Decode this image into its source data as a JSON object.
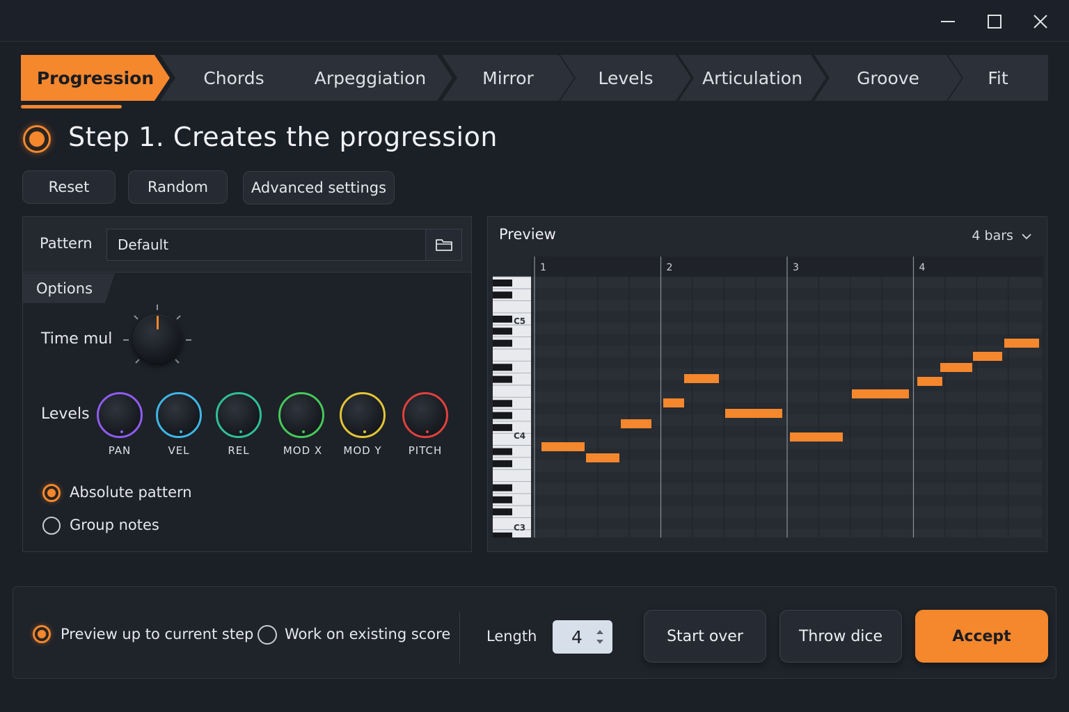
{
  "window": {
    "minimize_icon": "minimize-icon",
    "maximize_icon": "maximize-icon",
    "close_icon": "close-icon"
  },
  "tabs": [
    {
      "label": "Progression",
      "active": true
    },
    {
      "label": "Chords"
    },
    {
      "label": "Arpeggiation"
    },
    {
      "label": "Mirror"
    },
    {
      "label": "Levels"
    },
    {
      "label": "Articulation"
    },
    {
      "label": "Groove"
    },
    {
      "label": "Fit"
    }
  ],
  "step": {
    "title": "Step 1. Creates the progression"
  },
  "actions": {
    "reset": "Reset",
    "random": "Random",
    "advanced": "Advanced settings"
  },
  "pattern": {
    "label": "Pattern",
    "value": "Default",
    "browse_icon": "folder-icon"
  },
  "options": {
    "tab_label": "Options",
    "time_mul_label": "Time mul",
    "levels_label": "Levels",
    "levels": [
      {
        "label": "PAN",
        "color": "#8f5cf0"
      },
      {
        "label": "VEL",
        "color": "#3fb6e6"
      },
      {
        "label": "REL",
        "color": "#2fbf97"
      },
      {
        "label": "MOD X",
        "color": "#46c95a"
      },
      {
        "label": "MOD Y",
        "color": "#e3c537"
      },
      {
        "label": "PITCH",
        "color": "#e0413c"
      }
    ],
    "absolute_pattern": {
      "label": "Absolute pattern",
      "checked": true
    },
    "group_notes": {
      "label": "Group notes",
      "checked": false
    }
  },
  "preview": {
    "title": "Preview",
    "bars_select": "4 bars",
    "bar_numbers": [
      "1",
      "2",
      "3",
      "4"
    ],
    "key_labels": [
      "C5",
      "C4",
      "C3"
    ],
    "note_color": "#f5872d"
  },
  "bottom": {
    "preview_up_to": {
      "label": "Preview up to current step",
      "checked": true
    },
    "work_on_existing": {
      "label": "Work on existing score",
      "checked": false
    },
    "length_label": "Length",
    "length_value": "4",
    "start_over": "Start over",
    "throw_dice": "Throw dice",
    "accept": "Accept"
  },
  "colors": {
    "accent": "#f5872d",
    "background": "#1b1f26"
  }
}
